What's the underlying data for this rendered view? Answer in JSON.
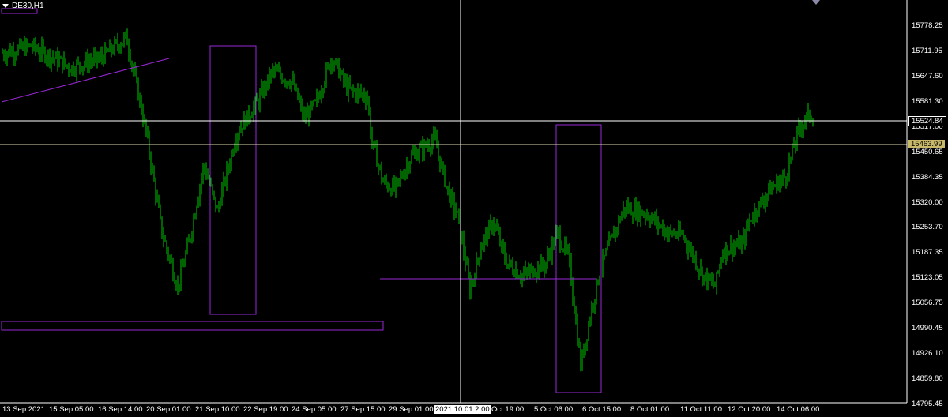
{
  "chart": {
    "symbol": "DE30,H1",
    "bid_price": "15524.84",
    "marked_price": "15463.99"
  },
  "colors": {
    "background": "#000000",
    "candle": "#00c800",
    "drawing": "#9a28d8",
    "grid": "#ffffff",
    "marker_fill": "#c8b86a"
  },
  "chart_data": {
    "type": "bar",
    "title": "DE30,H1",
    "y_ticks": [
      "15778.25",
      "15711.95",
      "15647.60",
      "15581.30",
      "15517.00",
      "15450.65",
      "15384.35",
      "15320.00",
      "15253.70",
      "15187.35",
      "15123.05",
      "15056.75",
      "14990.45",
      "14926.10",
      "14859.80",
      "14795.45"
    ],
    "ylim": [
      14795.45,
      15778.25
    ],
    "x_ticks": [
      "13 Sep 2021",
      "15 Sep 05:00",
      "16 Sep 14:00",
      "20 Sep 01:00",
      "21 Sep 10:00",
      "22 Sep 19:00",
      "24 Sep 05:00",
      "27 Sep 15:00",
      "29 Sep 01:00",
      "2021.10.01 2:00",
      "Oct 19:00",
      "5 Oct 06:00",
      "6 Oct 15:00",
      "8 Oct 01:00",
      "11 Oct 11:00",
      "12 Oct 20:00",
      "14 Oct 06:00"
    ],
    "cursor_x_label": "2021.10.01 2:00",
    "series": [
      {
        "x": [
          "13 Sep 2021",
          "15 Sep 05:00",
          "16 Sep 14:00",
          "20 Sep 01:00",
          "21 Sep 10:00",
          "22 Sep 19:00",
          "24 Sep 05:00",
          "27 Sep 15:00",
          "29 Sep 01:00",
          "2021.10.01 2:00",
          "Oct 19:00",
          "5 Oct 06:00",
          "6 Oct 15:00",
          "8 Oct 01:00",
          "11 Oct 11:00",
          "12 Oct 20:00",
          "14 Oct 06:00"
        ],
        "values": [
          15700,
          15690,
          15650,
          15080,
          15300,
          15560,
          15580,
          15540,
          15350,
          15160,
          15120,
          15100,
          15110,
          15240,
          15150,
          15290,
          15530
        ]
      }
    ],
    "grid": false,
    "legend": "none"
  }
}
